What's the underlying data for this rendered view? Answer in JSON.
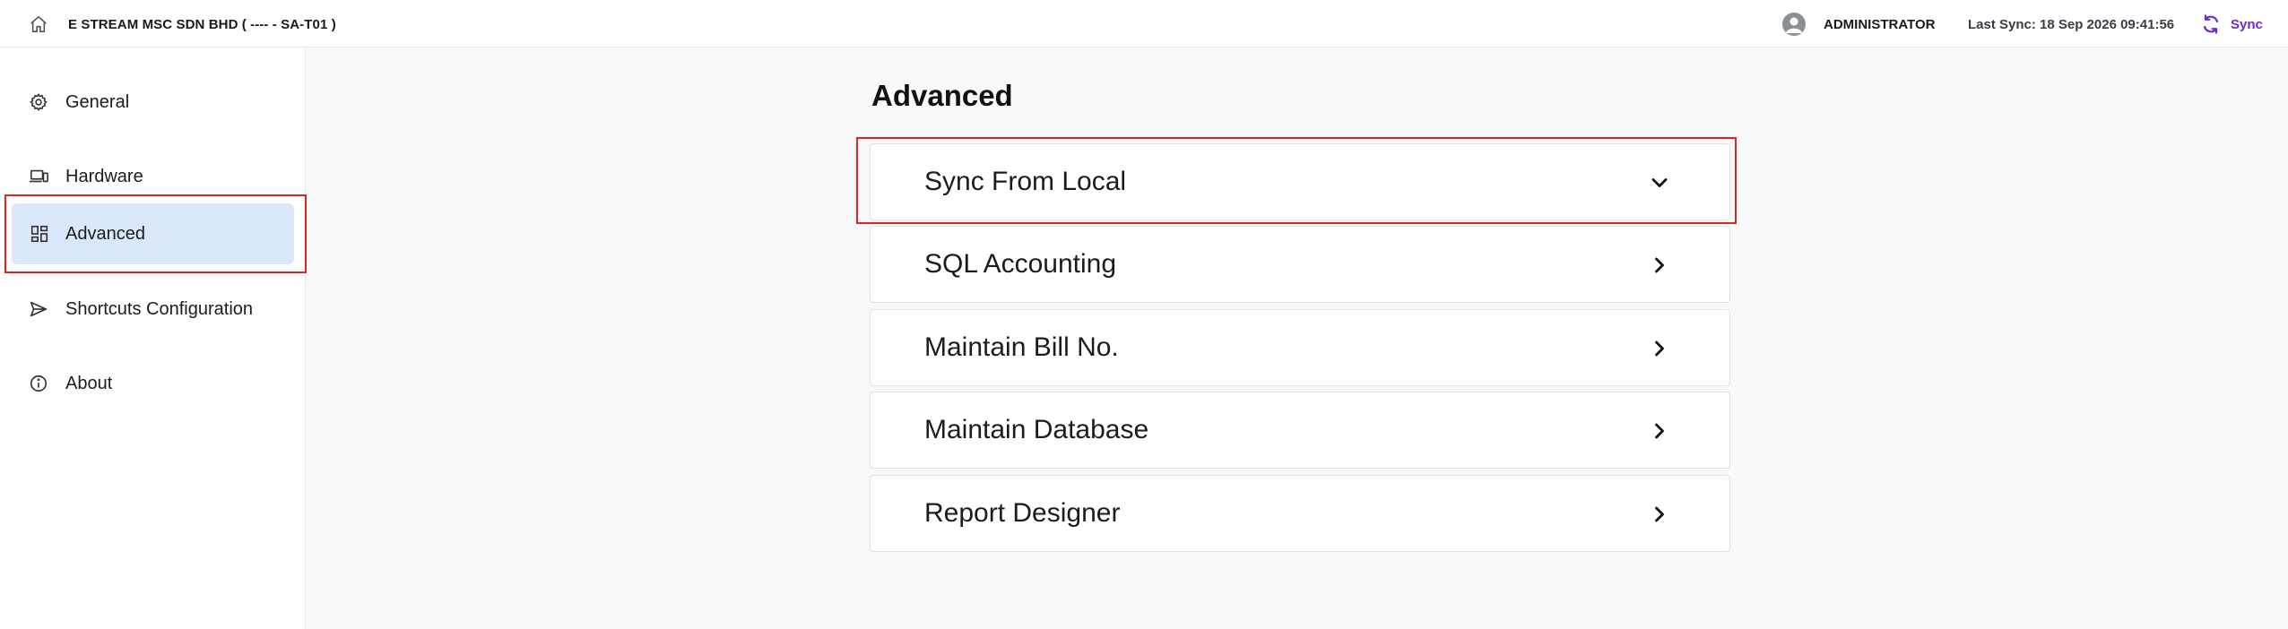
{
  "header": {
    "company": "E STREAM MSC SDN BHD ( ---- - SA-T01 )",
    "user": "ADMINISTRATOR",
    "last_sync": "Last Sync: 18 Sep 2026 09:41:56",
    "sync_label": "Sync",
    "accent_color": "#6d28d9"
  },
  "sidebar": {
    "items": [
      {
        "label": "General",
        "icon": "gear-icon"
      },
      {
        "label": "Hardware",
        "icon": "devices-icon"
      },
      {
        "label": "Advanced",
        "icon": "dashboard-grid-icon",
        "active": true
      },
      {
        "label": "Shortcuts Configuration",
        "icon": "send-icon"
      },
      {
        "label": "About",
        "icon": "info-icon"
      }
    ]
  },
  "main": {
    "title": "Advanced",
    "sections": [
      {
        "label": "Sync From Local",
        "expanded": true
      },
      {
        "label": "SQL Accounting",
        "expanded": false
      },
      {
        "label": "Maintain Bill No.",
        "expanded": false
      },
      {
        "label": "Maintain Database",
        "expanded": false
      },
      {
        "label": "Report Designer",
        "expanded": false
      }
    ]
  },
  "highlight_color": "#e02424"
}
